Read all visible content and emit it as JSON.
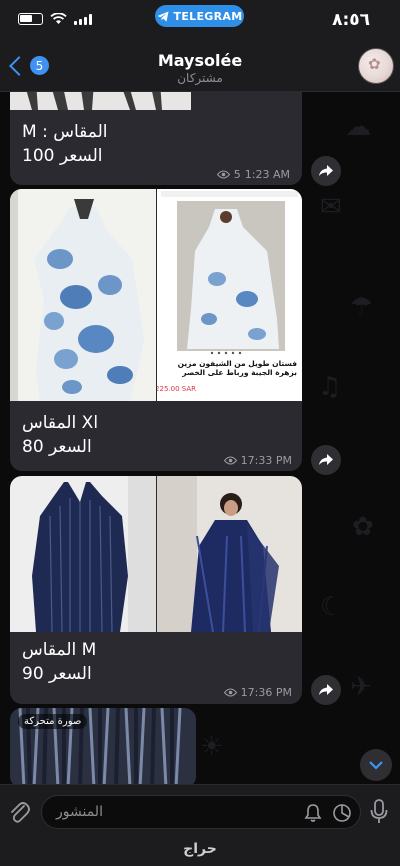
{
  "status_bar": {
    "time": "٨:٥٦",
    "pill_label": "TELEGRAM"
  },
  "header": {
    "back_count": "5",
    "title": "Maysolée",
    "subtitle": "مشتركان"
  },
  "messages": [
    {
      "size_line": "M : المقاس",
      "price_line": "السعر 100",
      "views": "5",
      "time": "1:23 AM"
    },
    {
      "size_line": "المقاس Xl",
      "price_line": "السعر 80",
      "time": "17:33 PM",
      "product_title": "فستان طويل من الشيفون مزين بزهرة الجيبة ورباط على الخصر",
      "product_price": "225.00 SAR"
    },
    {
      "size_line": "المقاس M",
      "price_line": "السعر 90",
      "time": "17:36 PM"
    },
    {
      "gif_badge": "صورة متحركة"
    }
  ],
  "input": {
    "placeholder": "المنشور"
  },
  "watermark": "حراج",
  "colors": {
    "accent": "#3e93f1",
    "bubble": "#2b2a31",
    "chat_bg": "#0b0b0c"
  }
}
